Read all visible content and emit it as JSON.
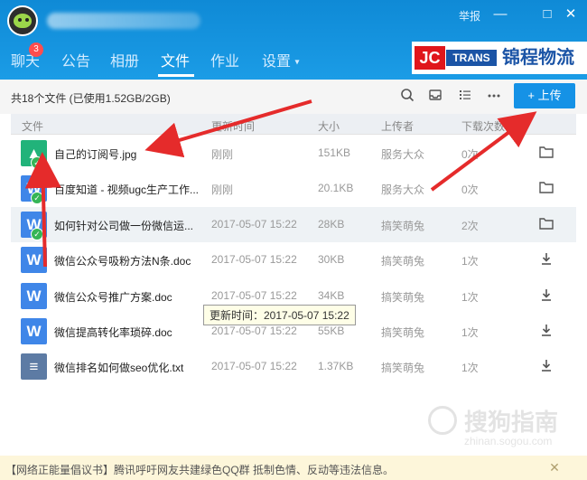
{
  "titlebar": {
    "report_label": "举报",
    "minimize_label": "—",
    "maximize_label": "□",
    "close_label": "✕"
  },
  "tabs": [
    {
      "label": "聊天",
      "badge": "3"
    },
    {
      "label": "公告"
    },
    {
      "label": "相册"
    },
    {
      "label": "文件",
      "active": true
    },
    {
      "label": "作业"
    },
    {
      "label": "设置"
    }
  ],
  "logo": {
    "jc": "JC",
    "trans": "TRANS",
    "cn": "锦程物流"
  },
  "toolbar": {
    "summary": "共18个文件 (已使用1.52GB/2GB)",
    "upload_label": "+ 上传"
  },
  "columns": {
    "name": "文件",
    "time": "更新时间",
    "size": "大小",
    "uploader": "上传者",
    "downloads": "下载次数"
  },
  "files": [
    {
      "name": "自己的订阅号.jpg",
      "time": "刚刚",
      "size": "151KB",
      "uploader": "服务大众",
      "downloads": "0次",
      "type": "image",
      "icon": "image-icon",
      "action": "open-folder-icon",
      "synced": true
    },
    {
      "name": "百度知道 - 视频ugc生产工作...",
      "time": "刚刚",
      "size": "20.1KB",
      "uploader": "服务大众",
      "downloads": "0次",
      "type": "word",
      "icon": "word-doc-icon",
      "action": "open-folder-icon",
      "synced": true
    },
    {
      "name": "如何针对公司做一份微信运...",
      "time": "2017-05-07 15:22",
      "size": "28KB",
      "uploader": "搞笑萌兔",
      "downloads": "2次",
      "type": "word",
      "icon": "word-doc-icon",
      "action": "open-folder-icon",
      "synced": true
    },
    {
      "name": "微信公众号吸粉方法N条.doc",
      "time": "2017-05-07 15:22",
      "size": "30KB",
      "uploader": "搞笑萌兔",
      "downloads": "1次",
      "type": "word",
      "icon": "word-doc-icon",
      "action": "download-icon"
    },
    {
      "name": "微信公众号推广方案.doc",
      "time": "2017-05-07 15:22",
      "size": "34KB",
      "uploader": "搞笑萌兔",
      "downloads": "1次",
      "type": "word",
      "icon": "word-doc-icon",
      "action": "download-icon"
    },
    {
      "name": "微信提高转化率琐碎.doc",
      "time": "2017-05-07 15:22",
      "size": "55KB",
      "uploader": "搞笑萌兔",
      "downloads": "1次",
      "type": "word",
      "icon": "word-doc-icon",
      "action": "download-icon"
    },
    {
      "name": "微信排名如何做seo优化.txt",
      "time": "2017-05-07 15:22",
      "size": "1.37KB",
      "uploader": "搞笑萌兔",
      "downloads": "1次",
      "type": "text",
      "icon": "text-file-icon",
      "action": "download-icon"
    }
  ],
  "tooltip": "更新时间：2017-05-07 15:22",
  "notice": "【网络正能量倡议书】腾讯呼吁网友共建绿色QQ群 抵制色情、反动等违法信息。",
  "watermark": {
    "cn": "搜狗指南",
    "url": "zhinan.sogou.com"
  },
  "colors": {
    "titlebar": "#1592e6",
    "upload_button": "#1592e6",
    "annotation_arrow": "#e52b2b",
    "notice_bg": "#fdf6da"
  }
}
